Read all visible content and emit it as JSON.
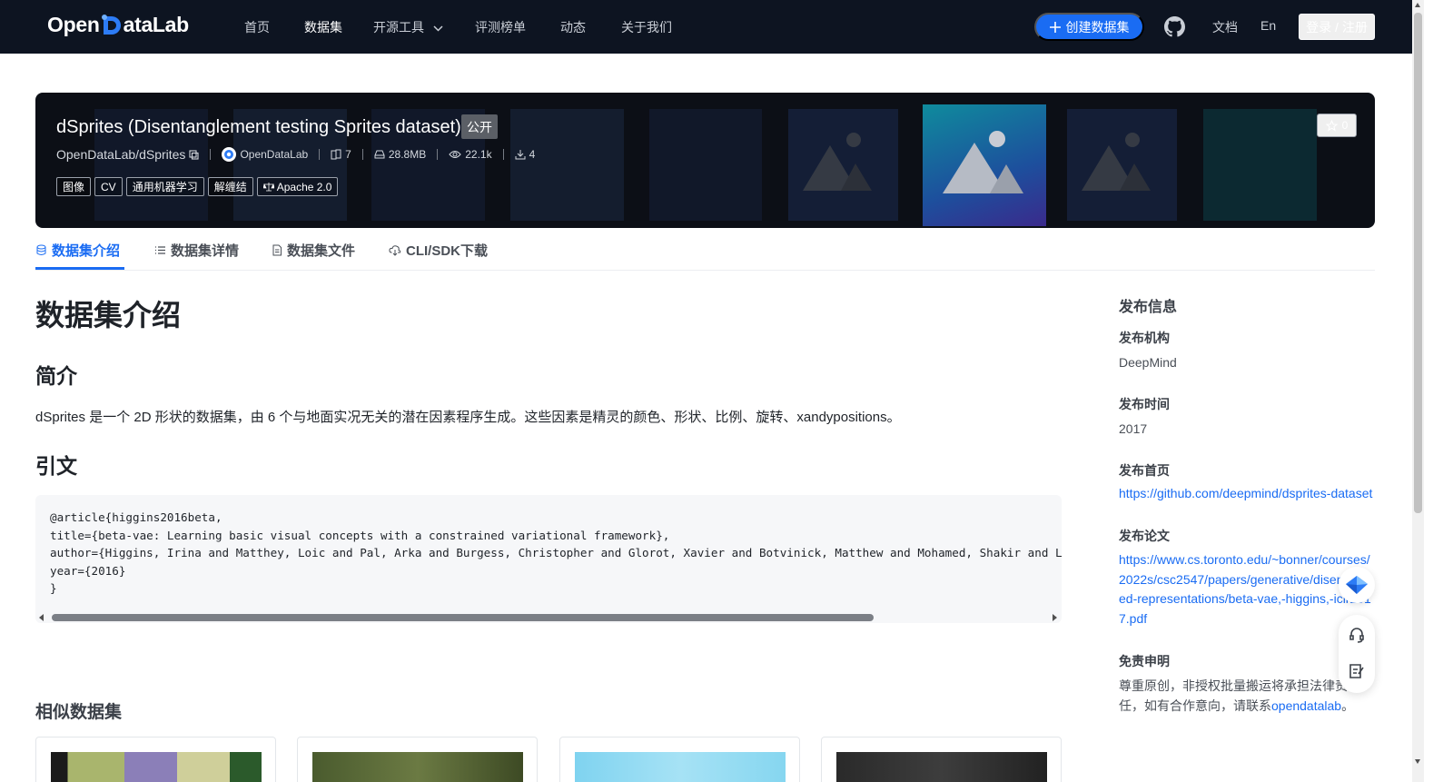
{
  "nav": {
    "logo_left": "Open",
    "logo_right": "ataLab",
    "items": [
      "首页",
      "数据集",
      "开源工具",
      "评测榜单",
      "动态",
      "关于我们"
    ],
    "create_label": "创建数据集",
    "docs": "文档",
    "lang": "En",
    "login": "登录 / 注册"
  },
  "dataset": {
    "title": "dSprites (Disentanglement testing Sprites dataset)",
    "visibility": "公开",
    "repo": "OpenDataLab/dSprites",
    "publisher": "OpenDataLab",
    "files": "7",
    "size": "28.8MB",
    "views": "22.1k",
    "downloads": "4",
    "tags": [
      "图像",
      "CV",
      "通用机器学习",
      "解缠结"
    ],
    "license": "Apache 2.0",
    "stars": "0"
  },
  "tabs": [
    "数据集介绍",
    "数据集详情",
    "数据集文件",
    "CLI/SDK下载"
  ],
  "content": {
    "heading": "数据集介绍",
    "intro_heading": "简介",
    "intro_text": "dSprites 是一个 2D 形状的数据集，由 6 个与地面实况无关的潜在因素程序生成。这些因素是精灵的颜色、形状、比例、旋转、xandypositions。",
    "citation_heading": "引文",
    "citation_lines": [
      "@article{higgins2016beta,",
      "title={beta-vae: Learning basic visual concepts with a constrained variational framework},",
      "author={Higgins, Irina and Matthey, Loic and Pal, Arka and Burgess, Christopher and Glorot, Xavier and Botvinick, Matthew and Mohamed, Shakir and Lerchner, Alexander},",
      "year={2016}",
      "}"
    ],
    "similar_heading": "相似数据集"
  },
  "sidebar": {
    "title": "发布信息",
    "org_label": "发布机构",
    "org_value": "DeepMind",
    "time_label": "发布时间",
    "time_value": "2017",
    "home_label": "发布首页",
    "home_value": "https://github.com/deepmind/dsprites-dataset",
    "paper_label": "发布论文",
    "paper_value": "https://www.cs.toronto.edu/~bonner/courses/2022s/csc2547/papers/generative/disentangled-representations/beta-vae,-higgins,-iclr2017.pdf",
    "disclaimer_label": "免责申明",
    "disclaimer_text": "尊重原创，非授权批量搬运将承担法律责任，如有合作意向，请联系",
    "disclaimer_link": "opendatalab",
    "disclaimer_end": "。"
  },
  "colors": {
    "accent": "#1a6cf3",
    "nav_bg": "#0d1421",
    "hero_bg": "#0c0f16"
  },
  "icons": {
    "plus": "plus-icon",
    "github": "github-icon",
    "star": "star-icon",
    "files": "file-copy-icon",
    "size": "storage-icon",
    "views": "eye-icon",
    "downloads": "download-icon",
    "license": "scale-icon",
    "service": "headset-icon",
    "feedback": "edit-note-icon"
  }
}
